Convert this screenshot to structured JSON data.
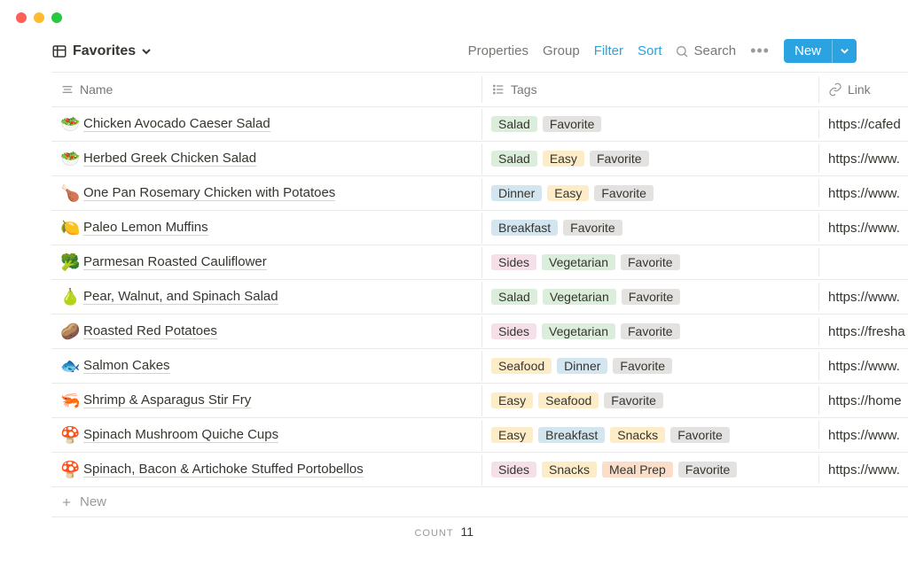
{
  "view": {
    "title": "Favorites"
  },
  "toolbar": {
    "properties": "Properties",
    "group": "Group",
    "filter": "Filter",
    "sort": "Sort",
    "search": "Search",
    "new": "New"
  },
  "columns": {
    "name": "Name",
    "tags": "Tags",
    "link": "Link"
  },
  "tag_colors": {
    "Salad": "#dbeddb",
    "Favorite": "#e3e2e0",
    "Easy": "#fdecc8",
    "Dinner": "#d3e5ef",
    "Breakfast": "#d3e5ef",
    "Sides": "#f5e0e9",
    "Vegetarian": "#dbeddb",
    "Seafood": "#fdecc8",
    "Snacks": "#fdecc8",
    "Meal Prep": "#fadec9"
  },
  "rows": [
    {
      "emoji": "🥗",
      "name": "Chicken Avocado Caeser Salad",
      "tags": [
        "Salad",
        "Favorite"
      ],
      "link": "https://cafed"
    },
    {
      "emoji": "🥗",
      "name": "Herbed Greek Chicken Salad",
      "tags": [
        "Salad",
        "Easy",
        "Favorite"
      ],
      "link": "https://www."
    },
    {
      "emoji": "🍗",
      "name": "One Pan Rosemary Chicken with Potatoes",
      "tags": [
        "Dinner",
        "Easy",
        "Favorite"
      ],
      "link": "https://www."
    },
    {
      "emoji": "🍋",
      "name": "Paleo Lemon Muffins",
      "tags": [
        "Breakfast",
        "Favorite"
      ],
      "link": "https://www."
    },
    {
      "emoji": "🥦",
      "name": "Parmesan Roasted Cauliflower",
      "tags": [
        "Sides",
        "Vegetarian",
        "Favorite"
      ],
      "link": ""
    },
    {
      "emoji": "🍐",
      "name": "Pear, Walnut, and Spinach Salad",
      "tags": [
        "Salad",
        "Vegetarian",
        "Favorite"
      ],
      "link": "https://www."
    },
    {
      "emoji": "🥔",
      "name": "Roasted Red Potatoes",
      "tags": [
        "Sides",
        "Vegetarian",
        "Favorite"
      ],
      "link": "https://fresha"
    },
    {
      "emoji": "🐟",
      "name": "Salmon Cakes",
      "tags": [
        "Seafood",
        "Dinner",
        "Favorite"
      ],
      "link": "https://www."
    },
    {
      "emoji": "🦐",
      "name": "Shrimp & Asparagus Stir Fry",
      "tags": [
        "Easy",
        "Seafood",
        "Favorite"
      ],
      "link": "https://home"
    },
    {
      "emoji": "🍄",
      "name": "Spinach Mushroom Quiche Cups",
      "tags": [
        "Easy",
        "Breakfast",
        "Snacks",
        "Favorite"
      ],
      "link": "https://www."
    },
    {
      "emoji": "🍄",
      "name": "Spinach, Bacon & Artichoke Stuffed Portobellos",
      "tags": [
        "Sides",
        "Snacks",
        "Meal Prep",
        "Favorite"
      ],
      "link": "https://www."
    }
  ],
  "addrow": {
    "label": "New"
  },
  "footer": {
    "count_label": "Count",
    "count": "11"
  }
}
